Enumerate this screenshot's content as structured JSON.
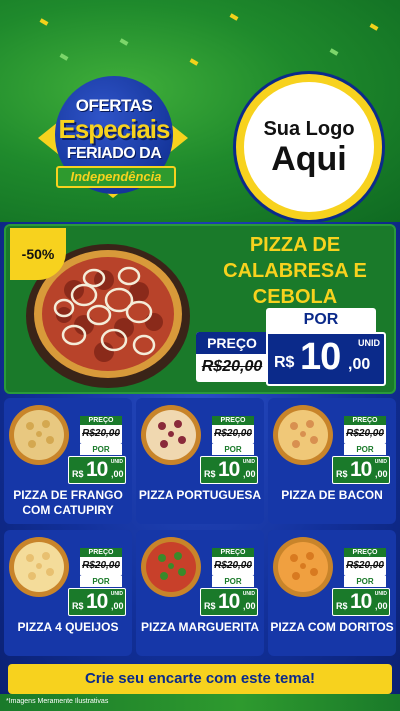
{
  "header": {
    "badge": {
      "line1": "OFERTAS",
      "line2": "Especiais",
      "line3": "FERIADO DA",
      "line4": "Independência"
    },
    "logo": {
      "line1": "Sua Logo",
      "line2": "Aqui"
    }
  },
  "featured": {
    "discount": "-50%",
    "title": "PIZZA DE CALABRESA E CEBOLA",
    "preco_label": "PREÇO",
    "old_price": "R$20,00",
    "por_label": "POR",
    "currency": "R$",
    "price_int": "10",
    "price_cents": ",00",
    "unit": "UNID"
  },
  "products": [
    {
      "name": "PIZZA DE FRANGO COM CATUPIRY",
      "preco_label": "PREÇO",
      "old_price": "R$20,00",
      "por_label": "POR",
      "currency": "R$",
      "price_int": "10",
      "price_cents": ",00",
      "unit": "UNID"
    },
    {
      "name": "PIZZA PORTUGUESA",
      "preco_label": "PREÇO",
      "old_price": "R$20,00",
      "por_label": "POR",
      "currency": "R$",
      "price_int": "10",
      "price_cents": ",00",
      "unit": "UNID"
    },
    {
      "name": "PIZZA DE BACON",
      "preco_label": "PREÇO",
      "old_price": "R$20,00",
      "por_label": "POR",
      "currency": "R$",
      "price_int": "10",
      "price_cents": ",00",
      "unit": "UNID"
    },
    {
      "name": "PIZZA 4 QUEIJOS",
      "preco_label": "PREÇO",
      "old_price": "R$20,00",
      "por_label": "POR",
      "currency": "R$",
      "price_int": "10",
      "price_cents": ",00",
      "unit": "UNID"
    },
    {
      "name": "PIZZA MARGUERITA",
      "preco_label": "PREÇO",
      "old_price": "R$20,00",
      "por_label": "POR",
      "currency": "R$",
      "price_int": "10",
      "price_cents": ",00",
      "unit": "UNID"
    },
    {
      "name": "PIZZA COM DORITOS",
      "preco_label": "PREÇO",
      "old_price": "R$20,00",
      "por_label": "POR",
      "currency": "R$",
      "price_int": "10",
      "price_cents": ",00",
      "unit": "UNID"
    }
  ],
  "cta": "Crie seu encarte com este tema!",
  "footnote": "*Imagens Meramente Ilustrativas",
  "colors": {
    "brand_green": "#1a7a2a",
    "brand_blue": "#0b2a8a",
    "brand_yellow": "#f7d21e"
  }
}
